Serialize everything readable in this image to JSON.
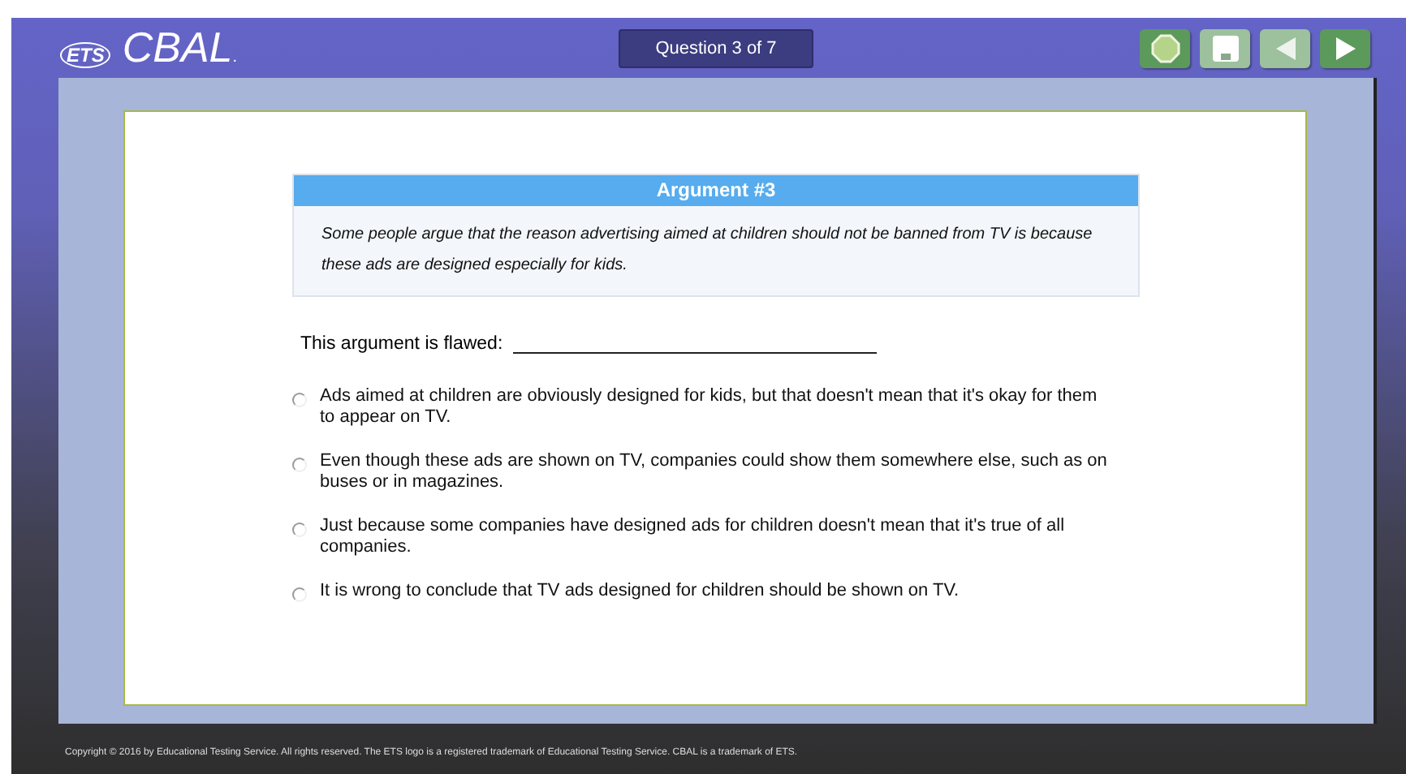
{
  "header": {
    "logo_mark": "ETS",
    "logo_text": "CBAL",
    "logo_suffix": ".",
    "question_counter": "Question 3 of 7",
    "buttons": [
      {
        "kind": "stop",
        "disabled": false
      },
      {
        "kind": "save",
        "disabled": true
      },
      {
        "kind": "back",
        "disabled": true
      },
      {
        "kind": "next",
        "disabled": false
      }
    ]
  },
  "argument": {
    "title": "Argument #3",
    "text": "Some people argue that the reason advertising aimed at children should not be banned from TV is because these ads are designed especially for kids."
  },
  "prompt": {
    "label": "This argument is flawed:"
  },
  "options": [
    {
      "text": "Ads aimed at children are obviously designed for kids, but that doesn't mean that it's okay for them to appear on TV.",
      "selected": false
    },
    {
      "text": "Even though these ads are shown on TV, companies could show them somewhere else, such as on buses or in magazines.",
      "selected": false
    },
    {
      "text": "Just because some companies have designed ads for children doesn't mean that it's true of all companies.",
      "selected": false
    },
    {
      "text": "It is wrong to conclude that TV ads designed for children should be shown on TV.",
      "selected": false
    }
  ],
  "footer": {
    "copyright": "Copyright © 2016 by Educational Testing Service. All rights reserved. The ETS logo is a registered trademark of Educational Testing Service. CBAL is a trademark of ETS."
  }
}
